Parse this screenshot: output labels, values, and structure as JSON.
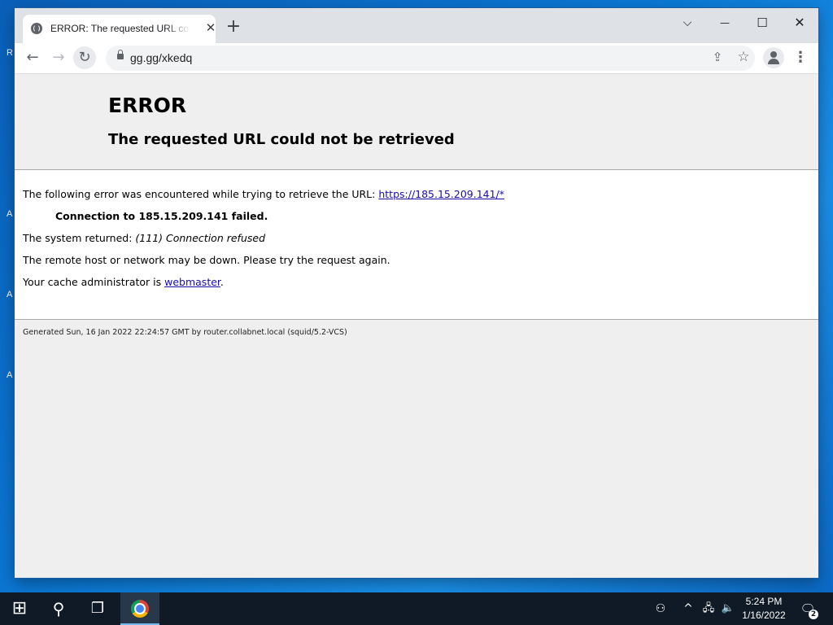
{
  "desktop": {
    "edge_letters": [
      "R",
      "A",
      "A",
      "A"
    ]
  },
  "browser": {
    "tab": {
      "title": "ERROR: The requested URL could not be retrieved",
      "close_glyph": "✕"
    },
    "new_tab_glyph": "+",
    "window_controls": {
      "dropdown": "⌵",
      "minimize": "—",
      "maximize": "☐",
      "close": "✕"
    },
    "nav": {
      "back": "←",
      "forward": "→",
      "reload": "↻"
    },
    "address_bar": {
      "url": "gg.gg/xkedq"
    },
    "share_glyph": "⇪",
    "star_glyph": "☆",
    "menu_glyph": "⋮"
  },
  "page": {
    "title": "ERROR",
    "subtitle": "The requested URL could not be retrieved",
    "line1_prefix": "The following error was encountered while trying to retrieve the URL: ",
    "line1_link": "https://185.15.209.141/*",
    "connection_failed": "Connection to 185.15.209.141 failed.",
    "system_returned_prefix": "The system returned: ",
    "system_returned_value": "(111) Connection refused",
    "remote_host_msg": "The remote host or network may be down. Please try the request again.",
    "admin_prefix": "Your cache administrator is ",
    "admin_link": "webmaster",
    "admin_suffix": ".",
    "footer": "Generated Sun, 16 Jan 2022 22:24:57 GMT by router.collabnet.local (squid/5.2-VCS)"
  },
  "taskbar": {
    "start_glyph": "⊞",
    "search_glyph": "⚲",
    "taskview_glyph": "❐",
    "people_glyph": "⚇",
    "chevron_glyph": "^",
    "network_glyph": "🖧",
    "volume_glyph": "🔈",
    "notification_glyph": "🗨",
    "notification_count": "2",
    "time": "5:24 PM",
    "date": "1/16/2022"
  }
}
